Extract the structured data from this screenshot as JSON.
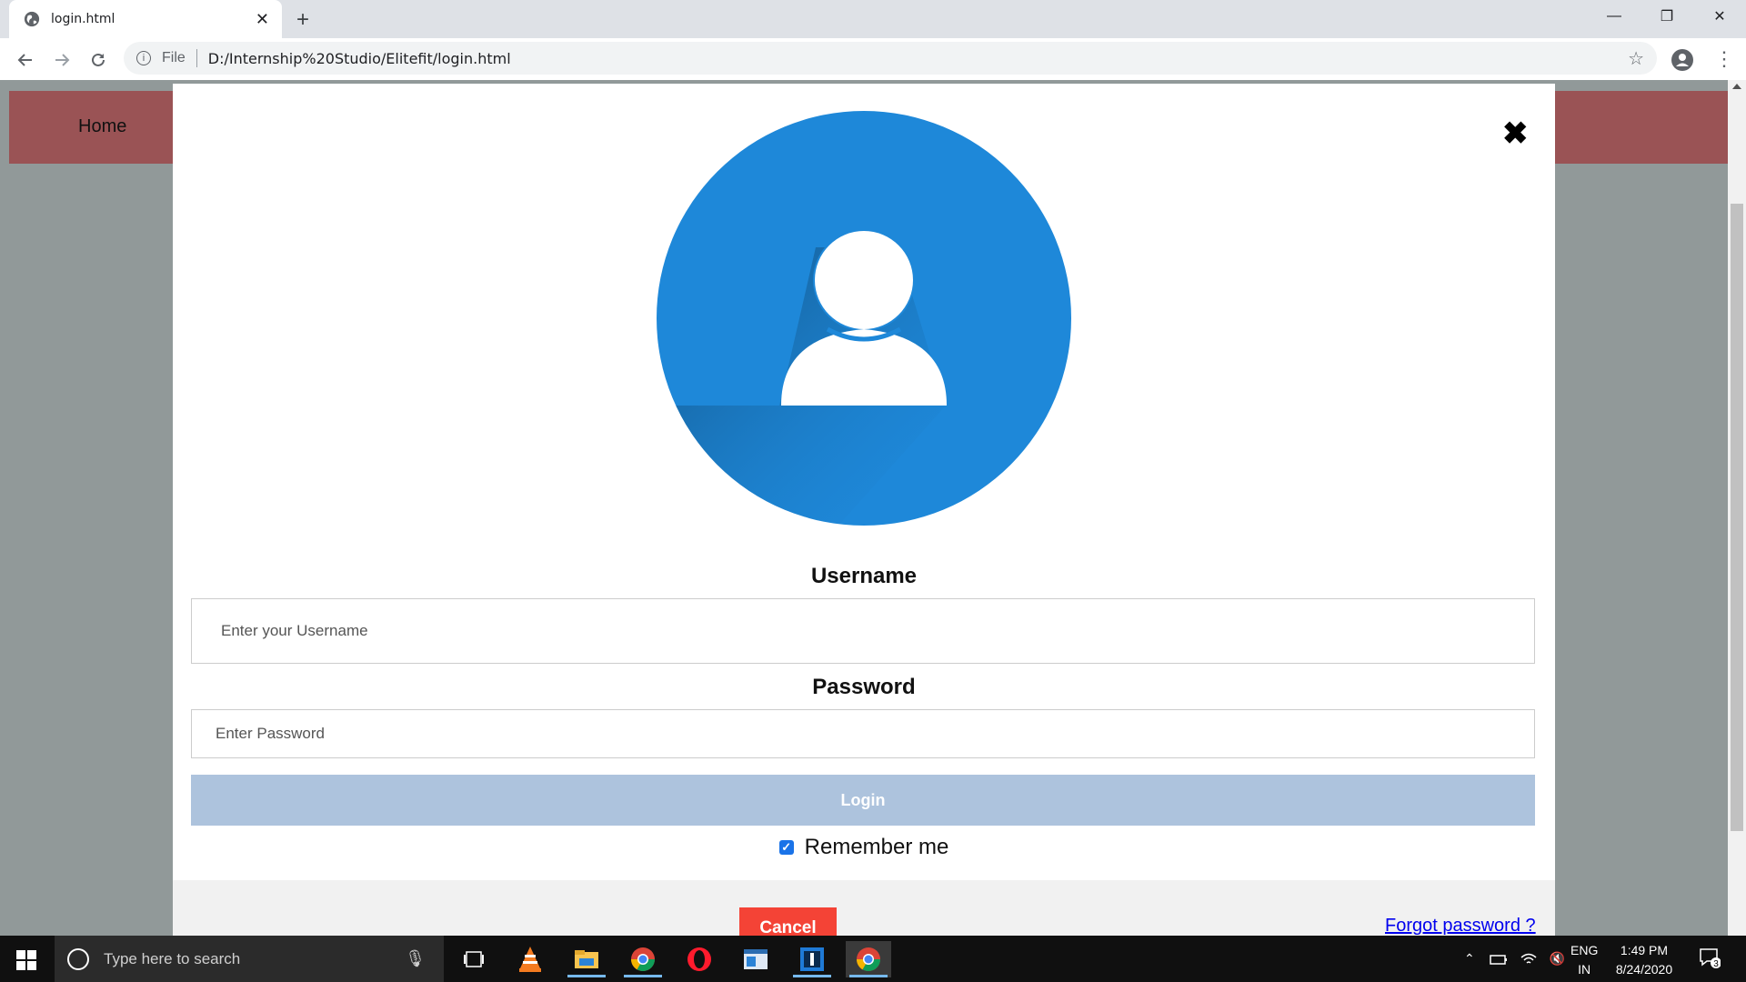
{
  "browser": {
    "tab_title": "login.html",
    "new_tab": "+",
    "close_tab": "✕",
    "scheme": "File",
    "url": "D:/Internship%20Studio/Elitefit/login.html",
    "minimize": "—",
    "maximize": "❐",
    "close": "✕"
  },
  "page": {
    "nav_home": "Home"
  },
  "modal": {
    "close": "✖",
    "username_label": "Username",
    "username_placeholder": "Enter your Username",
    "password_label": "Password",
    "password_placeholder": "Enter Password",
    "login_label": "Login",
    "remember_label": "Remember me",
    "remember_checked": true,
    "cancel_label": "Cancel",
    "forgot_label": "Forgot password ?"
  },
  "colors": {
    "avatar_blue": "#1e88d9",
    "navbar": "#9a5355",
    "login_button": "#adc3dd",
    "cancel_button": "#f44336"
  },
  "taskbar": {
    "search_placeholder": "Type here to search",
    "lang_top": "ENG",
    "lang_bottom": "IN",
    "time": "1:49 PM",
    "date": "8/24/2020",
    "notification_count": "3",
    "apps": [
      "task-view",
      "vlc",
      "file-explorer",
      "chrome",
      "opera",
      "app-window",
      "app-bracket",
      "chrome-active"
    ]
  }
}
